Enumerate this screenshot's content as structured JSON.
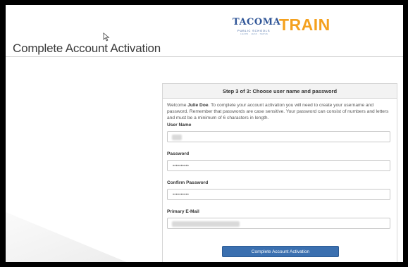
{
  "page": {
    "title": "Complete Account Activation"
  },
  "logo": {
    "tacoma": "TACOMA",
    "sub1": "PUBLIC SCHOOLS",
    "sub2": "LEARN · LEAD · SERVE",
    "train": "TRAIN"
  },
  "panel": {
    "header": "Step 3 of 3: Choose user name and password",
    "intro_before_name": "Welcome ",
    "user_display_name": "Julie Doe",
    "intro_after_name": ". To complete your account activation you will need to create your username and password. Remember that passwords are case sensitive. Your password can consist of numbers and letters and must be a minimum of 6 characters in length.",
    "fields": {
      "username": {
        "label": "User Name",
        "value": ""
      },
      "password": {
        "label": "Password",
        "value": "••••••••••"
      },
      "confirm_password": {
        "label": "Confirm Password",
        "value": "••••••••••"
      },
      "email": {
        "label": "Primary E-Mail",
        "value": ""
      }
    },
    "submit_label": "Complete Account Activation"
  },
  "colors": {
    "brand_blue": "#2f5597",
    "brand_orange": "#f4a11f",
    "button_blue": "#3b70b0"
  }
}
